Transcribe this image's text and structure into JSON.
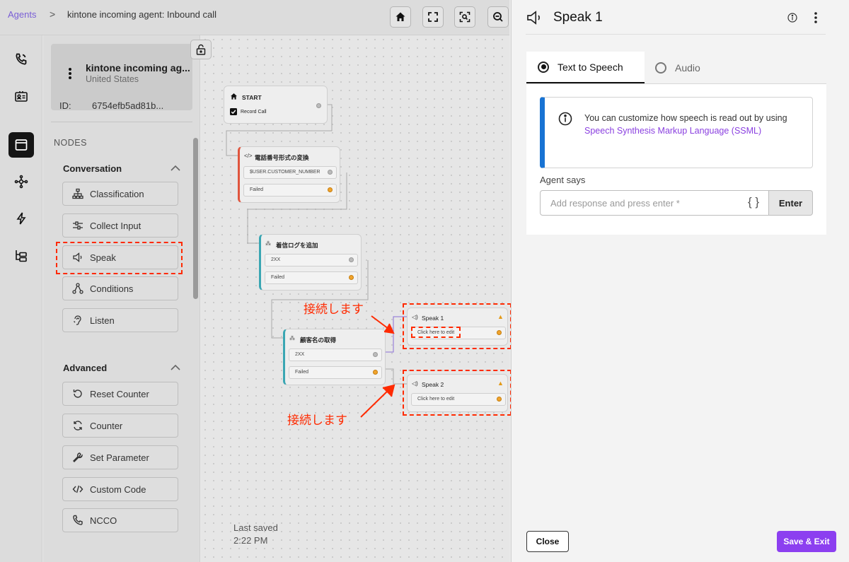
{
  "breadcrumb": {
    "root": "Agents",
    "separator": ">",
    "current": "kintone incoming agent: Inbound call"
  },
  "agent": {
    "name": "kintone incoming ag...",
    "country": "United States",
    "id_label": "ID:",
    "id_value": "6754efb5ad81b..."
  },
  "sidebar": {
    "nodes_title": "NODES",
    "conversation": {
      "title": "Conversation",
      "items": [
        {
          "label": "Classification",
          "icon": "classification-icon"
        },
        {
          "label": "Collect Input",
          "icon": "collect-input-icon"
        },
        {
          "label": "Speak",
          "icon": "speaker-icon"
        },
        {
          "label": "Conditions",
          "icon": "conditions-icon"
        },
        {
          "label": "Listen",
          "icon": "listen-icon"
        }
      ]
    },
    "advanced": {
      "title": "Advanced",
      "items": [
        {
          "label": "Reset Counter",
          "icon": "reset-icon"
        },
        {
          "label": "Counter",
          "icon": "counter-icon"
        },
        {
          "label": "Set Parameter",
          "icon": "wrench-icon"
        },
        {
          "label": "Custom Code",
          "icon": "code-icon"
        },
        {
          "label": "NCCO",
          "icon": "phone-icon"
        }
      ]
    }
  },
  "canvas": {
    "nodes": {
      "start": {
        "title": "START",
        "row": "Record Call"
      },
      "convert": {
        "title": "電話番号形式の変換",
        "row1": "$USER.CUSTOMER_NUMBER",
        "row2": "Failed"
      },
      "log": {
        "title": "着信ログを追加",
        "row1": "2XX",
        "row2": "Failed"
      },
      "customer": {
        "title": "顧客名の取得",
        "row1": "2XX",
        "row2": "Failed"
      },
      "speak1": {
        "title": "Speak 1",
        "row": "Click here to edit"
      },
      "speak2": {
        "title": "Speak 2",
        "row": "Click here to edit"
      }
    },
    "annotation1": "接続します",
    "annotation2": "接続します",
    "last_saved_label": "Last saved",
    "last_saved_time": "2:22 PM"
  },
  "panel": {
    "title": "Speak 1",
    "tabs": [
      {
        "label": "Text to Speech",
        "selected": true
      },
      {
        "label": "Audio",
        "selected": false
      }
    ],
    "info_text": "You can customize how speech is read out by using",
    "info_link": "Speech Synthesis Markup Language (SSML)",
    "agent_says_label": "Agent says",
    "input_placeholder": "Add response and press enter *",
    "braces": "{ }",
    "enter_label": "Enter",
    "close_label": "Close",
    "save_label": "Save & Exit"
  },
  "colors": {
    "accent": "#8c3ff0",
    "link": "#8a3fe0",
    "info_bar": "#1873d3",
    "annotation": "#ff2a00",
    "teal": "#3aa6b3",
    "red_accent": "#e0553d"
  }
}
